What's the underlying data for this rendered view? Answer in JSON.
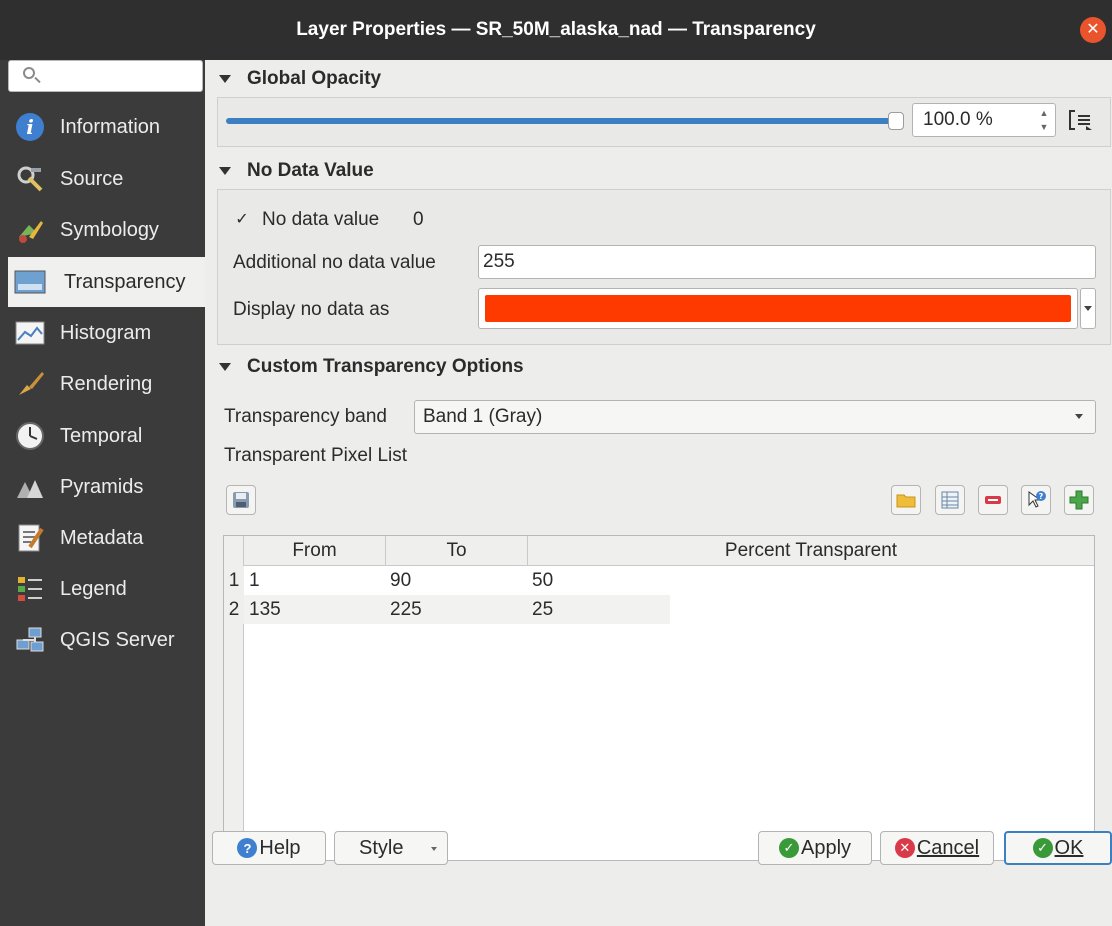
{
  "window": {
    "title": "Layer Properties — SR_50M_alaska_nad — Transparency",
    "close_icon": "close-icon"
  },
  "sidebar": {
    "search_placeholder": "",
    "items": [
      {
        "label": "Information",
        "icon": "info-icon"
      },
      {
        "label": "Source",
        "icon": "source-icon"
      },
      {
        "label": "Symbology",
        "icon": "symbology-icon"
      },
      {
        "label": "Transparency",
        "icon": "transparency-icon",
        "active": true
      },
      {
        "label": "Histogram",
        "icon": "histogram-icon"
      },
      {
        "label": "Rendering",
        "icon": "rendering-icon"
      },
      {
        "label": "Temporal",
        "icon": "clock-icon"
      },
      {
        "label": "Pyramids",
        "icon": "pyramids-icon"
      },
      {
        "label": "Metadata",
        "icon": "metadata-icon"
      },
      {
        "label": "Legend",
        "icon": "legend-icon"
      },
      {
        "label": "QGIS Server",
        "icon": "server-icon"
      }
    ]
  },
  "global_opacity": {
    "title": "Global Opacity",
    "value": "100.0 %",
    "slider_fraction": 1.0
  },
  "no_data": {
    "title": "No Data Value",
    "checkbox_label": "No data value",
    "checkbox_checked": true,
    "no_data_value": "0",
    "additional_label": "Additional no data value",
    "additional_value": "255",
    "display_label": "Display no data as",
    "display_color": "#ff3a00"
  },
  "custom": {
    "title": "Custom Transparency Options",
    "band_label": "Transparency band",
    "band_value": "Band 1 (Gray)",
    "pixel_list_label": "Transparent Pixel List",
    "table": {
      "headers": [
        "From",
        "To",
        "Percent Transparent"
      ],
      "rows": [
        {
          "num": "1",
          "from": "1",
          "to": "90",
          "percent": "50"
        },
        {
          "num": "2",
          "from": "135",
          "to": "225",
          "percent": "25"
        }
      ]
    }
  },
  "buttons": {
    "help": "Help",
    "style": "Style",
    "apply": "Apply",
    "cancel": "Cancel",
    "ok": "OK"
  },
  "colors": {
    "accent": "#3d7fc3",
    "sidebar_bg": "#3b3b3b",
    "titlebar_bg": "#2f2f2f"
  }
}
